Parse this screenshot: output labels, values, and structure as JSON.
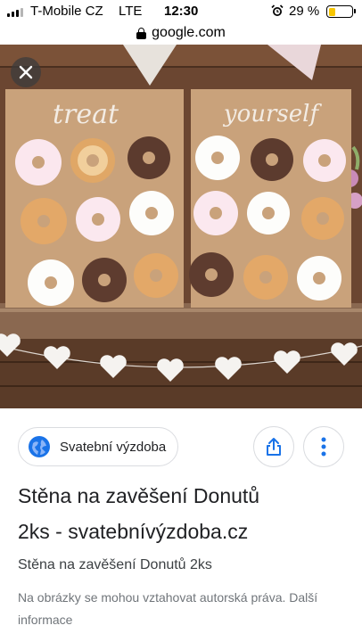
{
  "status_bar": {
    "carrier": "T-Mobile CZ",
    "network": "LTE",
    "time": "12:30",
    "battery_percent": "29 %",
    "battery_level": 0.29,
    "alarm_icon": "alarm-clock-icon"
  },
  "url_bar": {
    "domain": "google.com",
    "lock_icon": "lock-icon"
  },
  "image": {
    "board_left_text": "treat",
    "board_right_text": "yourself",
    "close_icon": "close-icon"
  },
  "info": {
    "source_name": "Svatební výzdoba",
    "source_icon": "globe-icon",
    "share_icon": "share-icon",
    "more_icon": "more-vertical-icon",
    "title_line1": "Stěna na zavěšení Donutů",
    "title_line2": "2ks - svatebnívýzdoba.cz",
    "subtitle": "Stěna na zavěšení Donutů 2ks",
    "notice_text": "Na obrázky se mohou vztahovat autorská práva. ",
    "notice_link": "Další informace"
  },
  "colors": {
    "accent_blue": "#1a73e8",
    "battery_yellow": "#f7c600",
    "kraft_board": "#c9a27b"
  }
}
